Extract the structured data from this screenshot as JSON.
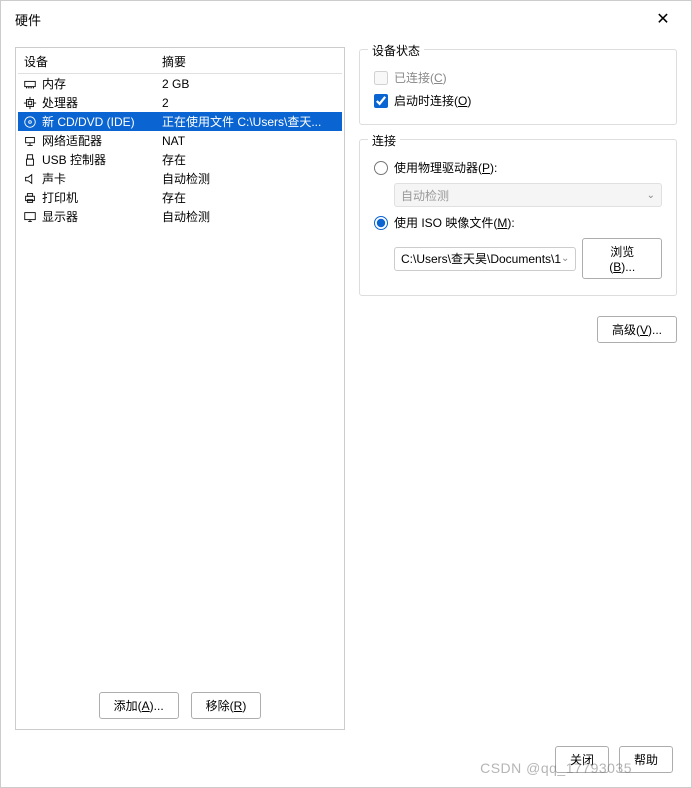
{
  "title": "硬件",
  "table": {
    "headers": {
      "device": "设备",
      "summary": "摘要"
    },
    "rows": [
      {
        "icon": "memory",
        "device": "内存",
        "summary": "2 GB",
        "selected": false
      },
      {
        "icon": "cpu",
        "device": "处理器",
        "summary": "2",
        "selected": false
      },
      {
        "icon": "cd",
        "device": "新 CD/DVD (IDE)",
        "summary": "正在使用文件 C:\\Users\\查天...",
        "selected": true
      },
      {
        "icon": "network",
        "device": "网络适配器",
        "summary": "NAT",
        "selected": false
      },
      {
        "icon": "usb",
        "device": "USB 控制器",
        "summary": "存在",
        "selected": false
      },
      {
        "icon": "sound",
        "device": "声卡",
        "summary": "自动检测",
        "selected": false
      },
      {
        "icon": "printer",
        "device": "打印机",
        "summary": "存在",
        "selected": false
      },
      {
        "icon": "display",
        "device": "显示器",
        "summary": "自动检测",
        "selected": false
      }
    ]
  },
  "left_buttons": {
    "add": {
      "text": "添加(",
      "hotkey": "A",
      "suffix": ")..."
    },
    "remove": {
      "text": "移除(",
      "hotkey": "R",
      "suffix": ")"
    }
  },
  "status_group": {
    "title": "设备状态",
    "connected": {
      "label": "已连接(",
      "hotkey": "C",
      "suffix": ")",
      "checked": false,
      "disabled": true
    },
    "connect_on": {
      "label": "启动时连接(",
      "hotkey": "O",
      "suffix": ")",
      "checked": true
    }
  },
  "connection_group": {
    "title": "连接",
    "physical": {
      "label": "使用物理驱动器(",
      "hotkey": "P",
      "suffix": "):",
      "checked": false
    },
    "physical_combo": "自动检测",
    "iso": {
      "label": "使用 ISO 映像文件(",
      "hotkey": "M",
      "suffix": "):",
      "checked": true
    },
    "iso_path": "C:\\Users\\查天昊\\Documents\\1",
    "browse": {
      "text": "浏览(",
      "hotkey": "B",
      "suffix": ")..."
    }
  },
  "advanced": {
    "text": "高级(",
    "hotkey": "V",
    "suffix": ")..."
  },
  "footer": {
    "close": "关闭",
    "help": "帮助"
  },
  "watermark": "CSDN @qq_17793035"
}
